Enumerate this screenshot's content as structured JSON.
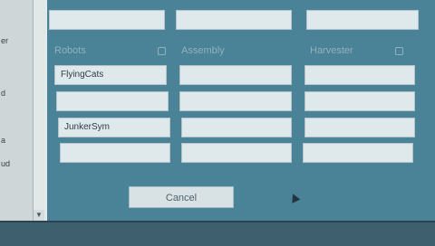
{
  "sidebar": {
    "labels": [
      "er",
      "d",
      "a",
      "ud"
    ]
  },
  "table": {
    "headers": [
      "Robots",
      "Assembly",
      "Harvester"
    ],
    "top_row": [
      "",
      "",
      ""
    ],
    "rows": [
      [
        "FlyingCats",
        "",
        ""
      ],
      [
        "",
        "",
        ""
      ],
      [
        "JunkerSym",
        "",
        ""
      ],
      [
        "",
        "",
        ""
      ]
    ]
  },
  "buttons": {
    "cancel_label": "Cancel"
  },
  "status_bar": {
    "text": ""
  }
}
